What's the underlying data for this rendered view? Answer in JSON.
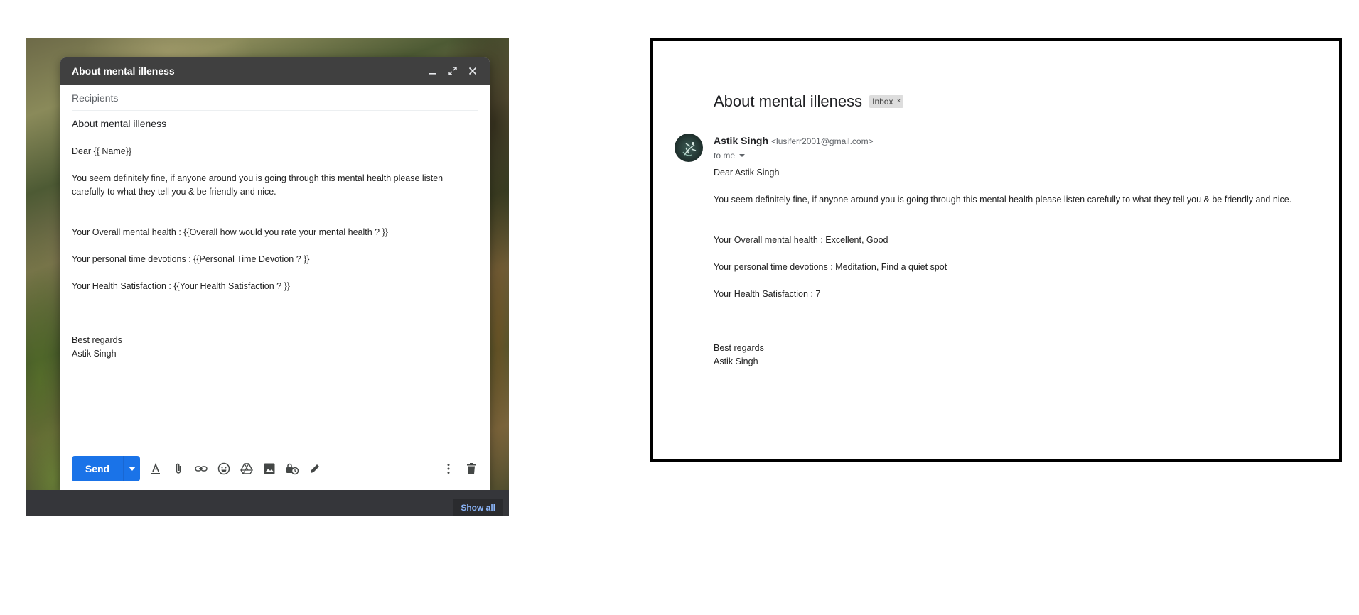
{
  "compose": {
    "title": "About mental illeness",
    "recipients_placeholder": "Recipients",
    "subject": "About mental illeness",
    "greeting": "Dear {{ Name}}",
    "intro": "You seem definitely fine,  if anyone around you is going through this mental health  please listen carefully to what they tell you & be friendly and nice.",
    "line_overall": "Your Overall mental health : {{Overall  how  would  you  rate  your  mental  health  ?  }}",
    "line_devotion": "Your personal time devotions : {{Personal  Time  Devotion ? }}",
    "line_satisfaction": "Your Health Satisfaction : {{Your Health Satisfaction ? }}",
    "closing": "Best regards",
    "signature": "Astik Singh",
    "send_label": "Send",
    "header_icons": [
      "minimize-icon",
      "expand-icon",
      "close-icon"
    ],
    "toolbar_icons": [
      "formatting-icon",
      "attach-icon",
      "link-icon",
      "emoji-icon",
      "drive-icon",
      "photo-icon",
      "confidential-icon",
      "signature-icon",
      "more-options-icon",
      "trash-icon"
    ]
  },
  "taskbar": {
    "show_all_label": "Show all"
  },
  "email": {
    "subject": "About mental illeness",
    "label_badge": "Inbox",
    "label_remove": "×",
    "sender_name": "Astik Singh",
    "sender_email": "<lusiferr2001@gmail.com>",
    "recipient": "to me",
    "greeting": "Dear Astik Singh",
    "intro": "You seem definitely fine,  if anyone around you is going through this mental health  please listen carefully to what they tell you & be friendly and nice.",
    "line_overall": "Your Overall mental health : Excellent, Good",
    "line_devotion": "Your personal time devotions : Meditation, Find a quiet spot",
    "line_satisfaction": "Your Health Satisfaction : 7",
    "closing": "Best regards",
    "signature": "Astik Singh"
  },
  "colors": {
    "send_button": "#1a73e8",
    "compose_header": "#404040",
    "show_all_text": "#8ab4f8",
    "taskbar": "#35363a"
  }
}
